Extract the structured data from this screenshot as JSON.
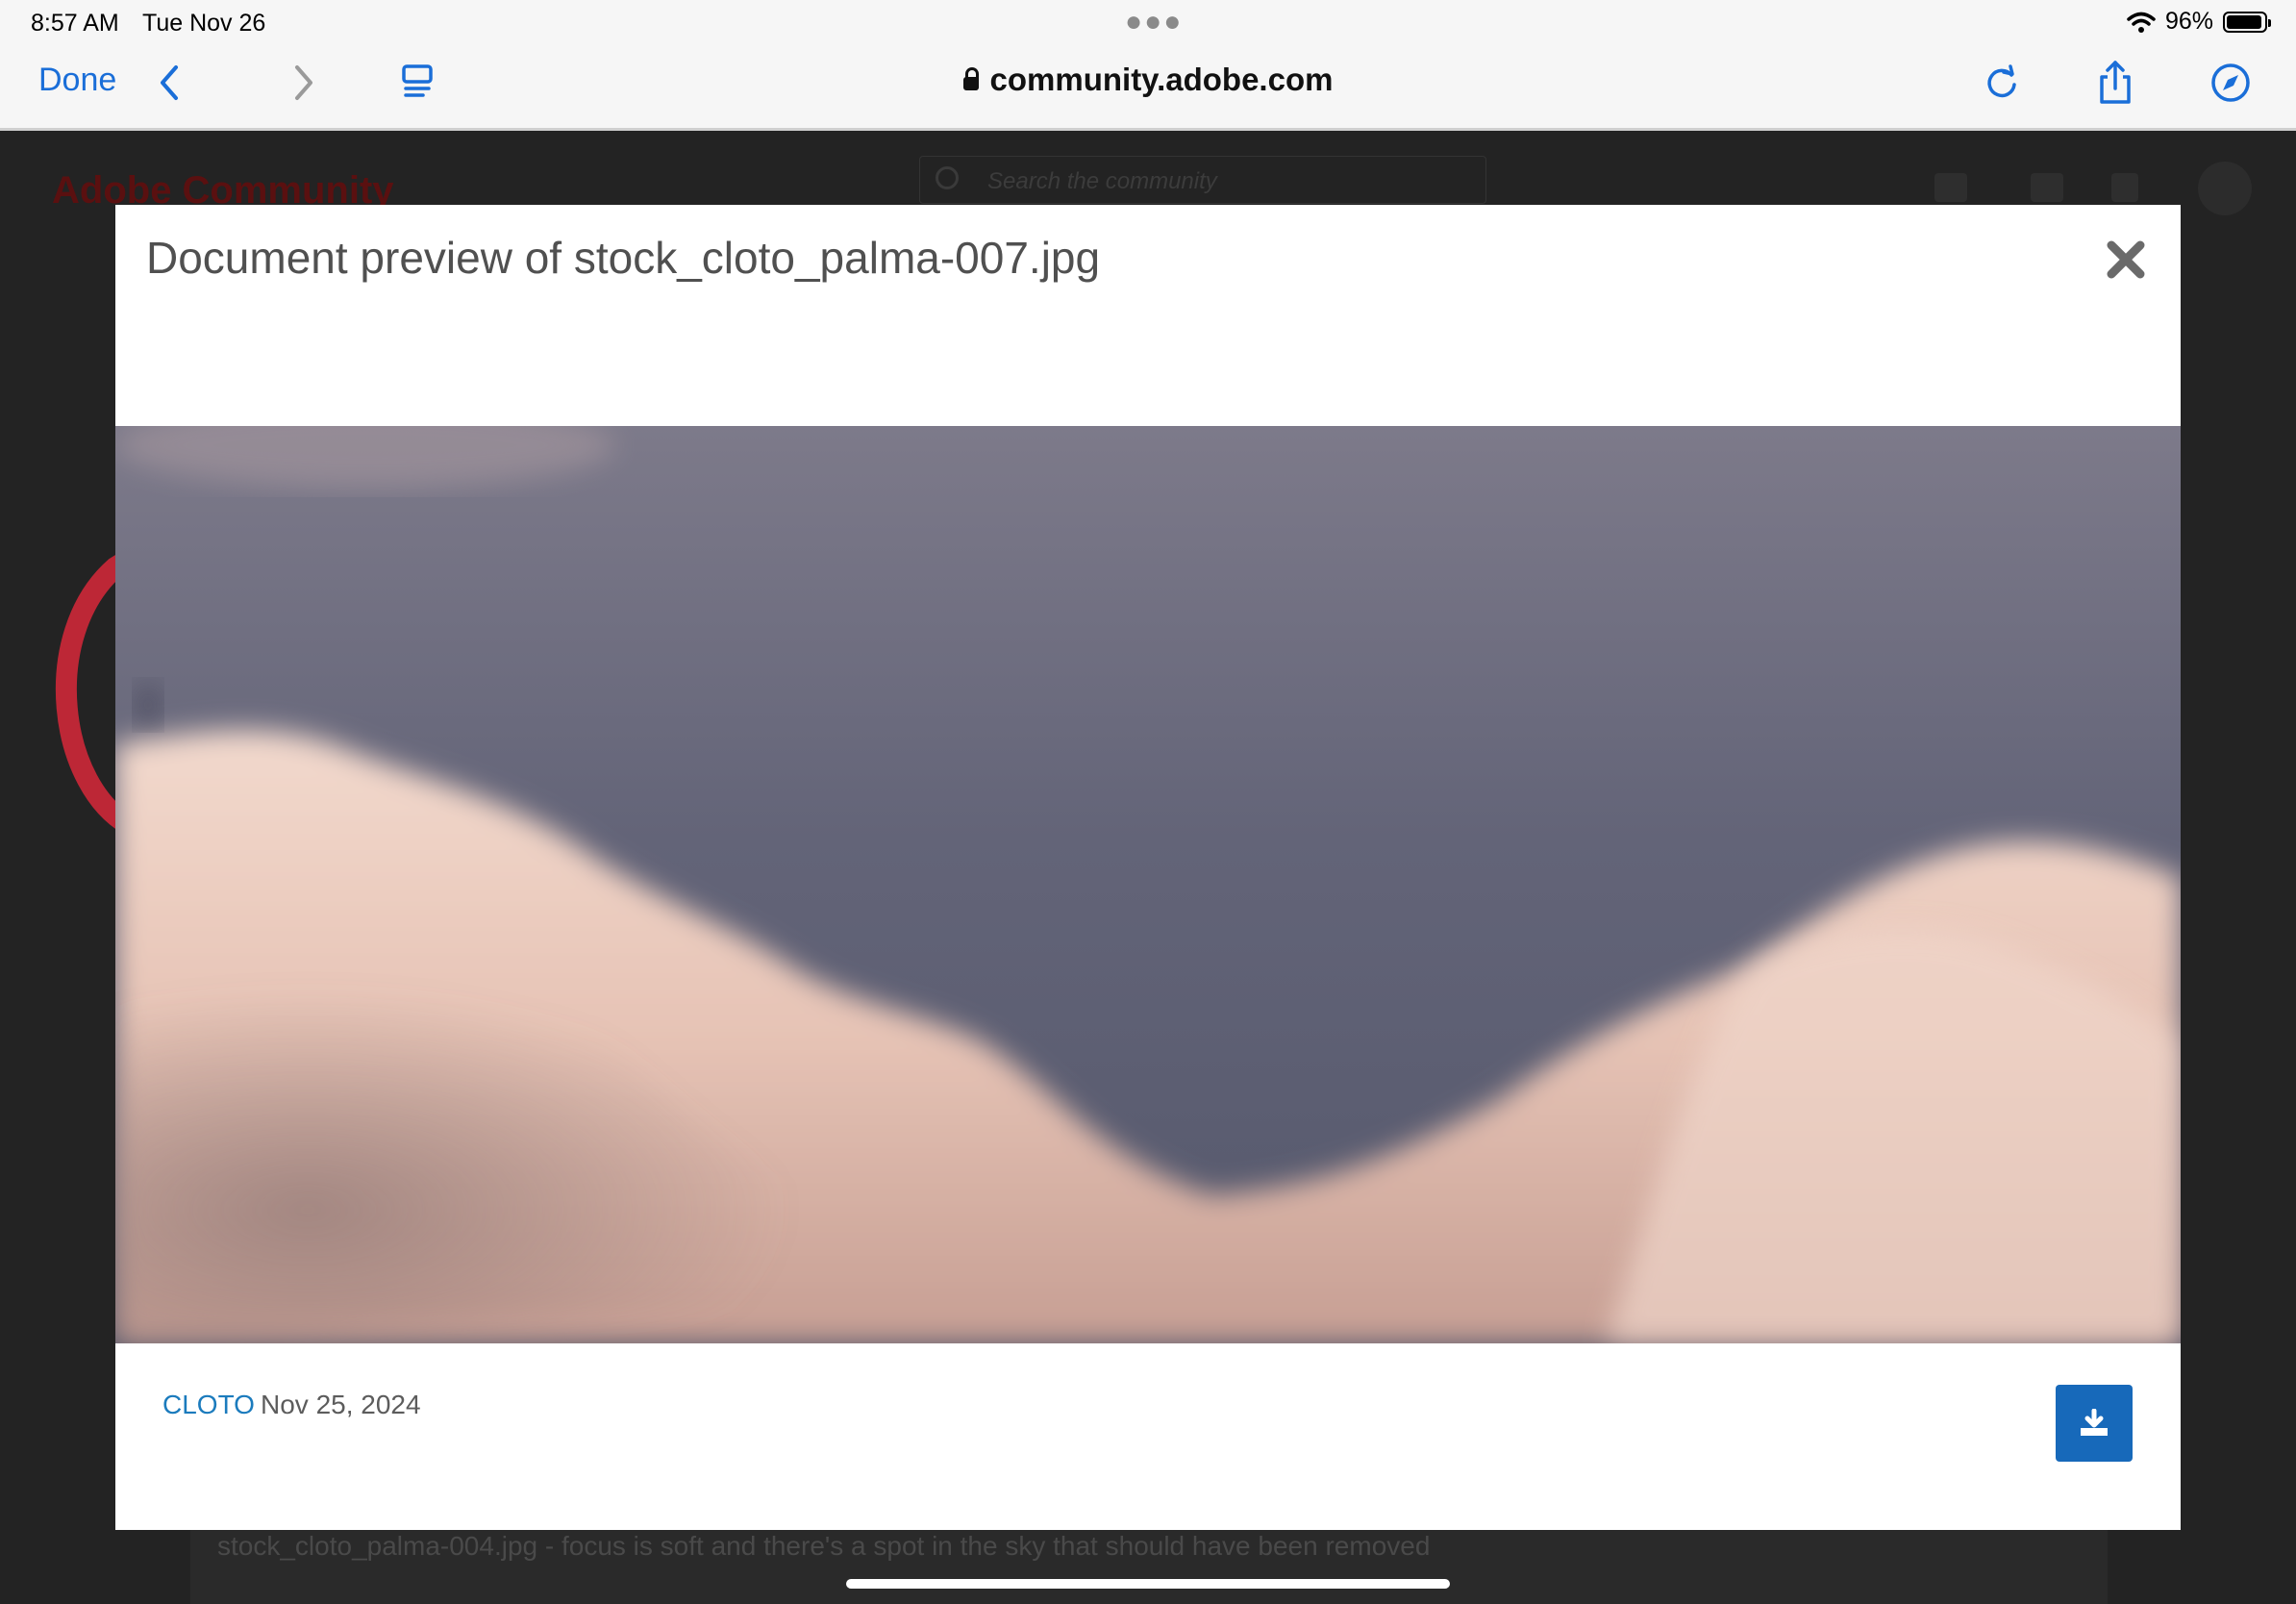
{
  "status_bar": {
    "time": "8:57 AM",
    "date": "Tue Nov 26",
    "battery": "96%",
    "battery_level": 0.96,
    "multitask_icon": "ellipsis-icon",
    "wifi_icon": "wifi-icon"
  },
  "browser": {
    "done_label": "Done",
    "url": "community.adobe.com",
    "icons": [
      "chevron-left-icon",
      "chevron-right-icon",
      "tabs-icon",
      "reload-icon",
      "share-icon",
      "compass-icon"
    ]
  },
  "background_page": {
    "brand": "Adobe Community",
    "search_placeholder": "Search the community",
    "post_text": "stock_cloto_palma-004.jpg - focus is soft and there's a spot in the sky that should have been removed"
  },
  "modal": {
    "title": "Document preview of stock_cloto_palma-007.jpg",
    "author": "CLOTO",
    "date": "Nov 25, 2024",
    "close_icon": "close-icon",
    "download_icon": "download-icon"
  },
  "colors": {
    "accent": "#1a6ed8",
    "download_button": "#1769ba",
    "author_link": "#1b7bbd",
    "annotation": "#d8283a"
  }
}
